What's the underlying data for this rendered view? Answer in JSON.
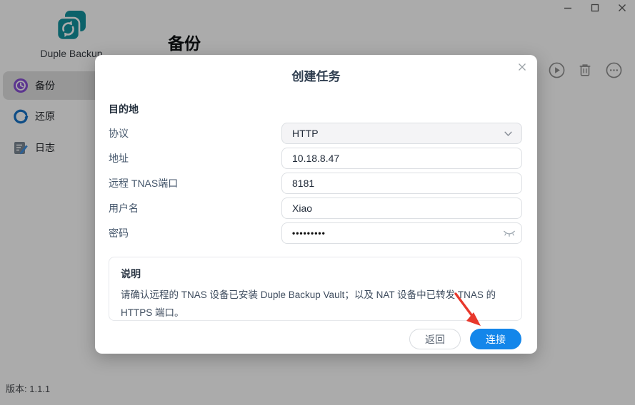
{
  "window": {
    "controls": {
      "minimize": "minimize",
      "maximize": "maximize",
      "close": "close"
    }
  },
  "app": {
    "name": "Duple Backup",
    "version_label": "版本: 1.1.1"
  },
  "sidebar": {
    "items": [
      {
        "label": "备份",
        "icon": "backup-clock-icon",
        "active": true
      },
      {
        "label": "还原",
        "icon": "restore-arrow-icon",
        "active": false
      },
      {
        "label": "日志",
        "icon": "log-document-icon",
        "active": false
      }
    ]
  },
  "page": {
    "title": "备份",
    "toolbar_icons": [
      "play-circle-icon",
      "trash-icon",
      "ellipsis-circle-icon"
    ]
  },
  "modal": {
    "title": "创建任务",
    "section_title": "目的地",
    "fields": [
      {
        "label": "协议",
        "value": "HTTP",
        "type": "select"
      },
      {
        "label": "地址",
        "value": "10.18.8.47",
        "type": "text"
      },
      {
        "label": "远程 TNAS端口",
        "value": "8181",
        "type": "text"
      },
      {
        "label": "用户名",
        "value": "Xiao",
        "type": "text"
      },
      {
        "label": "密码",
        "value": "•••••••••",
        "type": "password"
      }
    ],
    "note": {
      "title": "说明",
      "body": "请确认远程的 TNAS 设备已安装 Duple Backup Vault；以及 NAT 设备中已转发 TNAS 的 HTTPS 端口。"
    },
    "buttons": {
      "back": "返回",
      "connect": "连接"
    }
  },
  "colors": {
    "accent_blue": "#1386ea",
    "logo_teal": "#13929e",
    "backup_icon_purple": "#8a4fd6",
    "restore_icon_blue": "#1673c8",
    "arrow_red": "#e8382c"
  }
}
